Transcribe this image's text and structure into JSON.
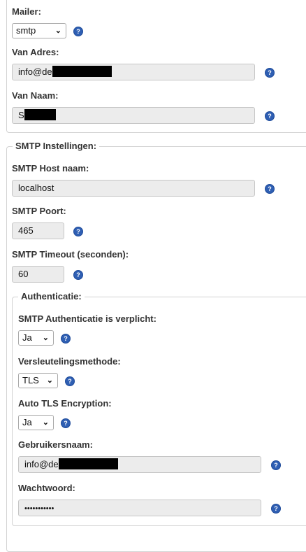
{
  "mail": {
    "mailer_label": "Mailer:",
    "mailer_value": "smtp",
    "from_address_label": "Van Adres:",
    "from_address_value": "info@de",
    "from_name_label": "Van Naam:",
    "from_name_value": "S"
  },
  "smtp": {
    "legend": "SMTP Instellingen:",
    "host_label": "SMTP Host naam:",
    "host_value": "localhost",
    "port_label": "SMTP Poort:",
    "port_value": "465",
    "timeout_label": "SMTP Timeout (seconden):",
    "timeout_value": "60"
  },
  "auth": {
    "legend": "Authenticatie:",
    "required_label": "SMTP Authenticatie is verplicht:",
    "required_value": "Ja",
    "encryption_label": "Versleutelingsmethode:",
    "encryption_value": "TLS",
    "auto_tls_label": "Auto TLS Encryption:",
    "auto_tls_value": "Ja",
    "username_label": "Gebruikersnaam:",
    "username_value": "info@de",
    "password_label": "Wachtwoord:",
    "password_value": "•••••••••••"
  },
  "icons": {
    "help": "question-mark-help-icon",
    "dropdown": "chevron-down-icon"
  },
  "colors": {
    "help_icon": "#2f5fb3",
    "input_bg": "#ececec",
    "border": "#d2d2d2",
    "redaction": "#000000"
  }
}
